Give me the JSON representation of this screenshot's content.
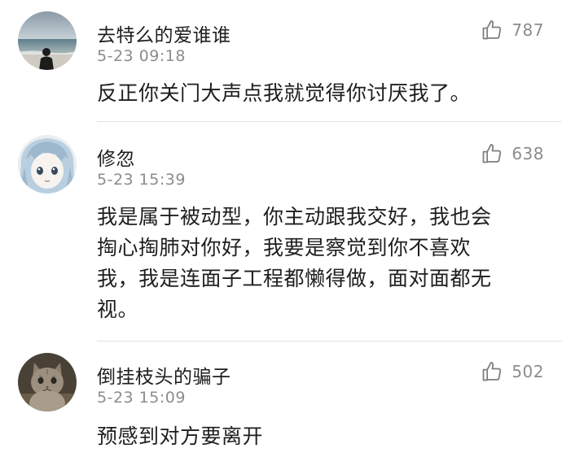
{
  "comments": [
    {
      "username": "去特么的爱谁谁",
      "timestamp": "5-23 09:18",
      "likes": "787",
      "text": "反正你关门大声点我就觉得你讨厌我了。",
      "avatar": "beach-silhouette-avatar"
    },
    {
      "username": "修忽",
      "timestamp": "5-23 15:39",
      "likes": "638",
      "text": "我是属于被动型，你主动跟我交好，我也会\n掏心掏肺对你好，我要是察觉到你不喜欢\n我，我是连面子工程都懒得做，面对面都无\n视。",
      "avatar": "anime-girl-avatar"
    },
    {
      "username": "倒挂枝头的骗子",
      "timestamp": "5-23 15:09",
      "likes": "502",
      "text": "预感到对方要离开",
      "avatar": "cat-avatar"
    }
  ],
  "icons": {
    "like": "thumbs-up-icon"
  },
  "colors": {
    "text": "#1e1e1e",
    "muted": "#8c8c8c",
    "divider": "#e4e4e4"
  }
}
